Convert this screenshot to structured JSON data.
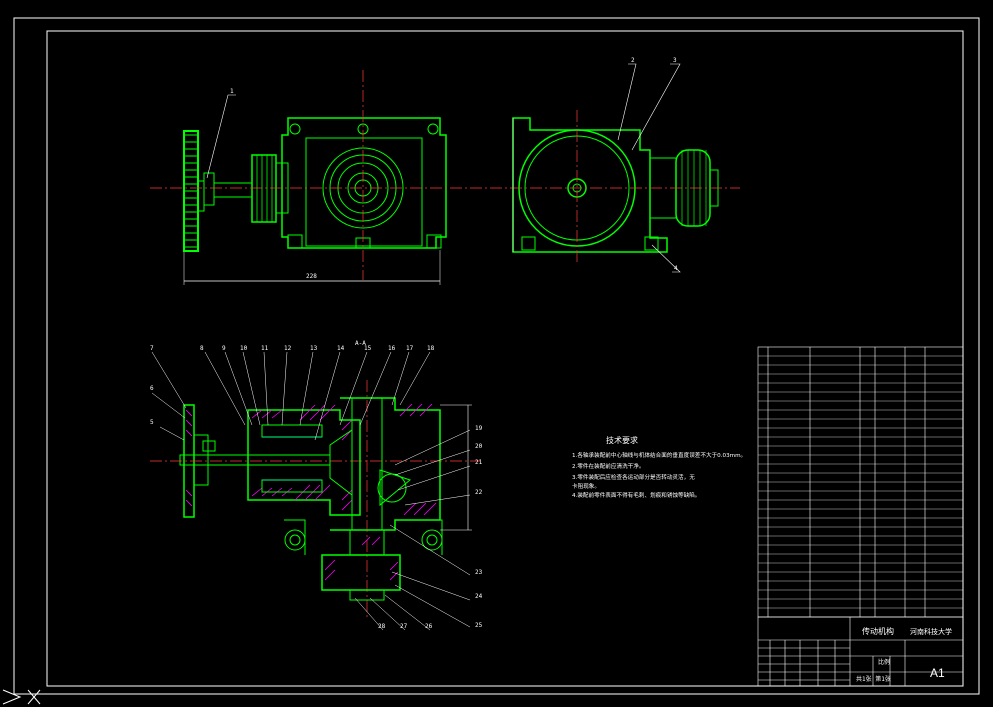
{
  "drawing": {
    "sheet_size": "A1",
    "part_labels_top": [
      "1",
      "2",
      "3",
      "4"
    ],
    "part_labels_section": [
      "5",
      "6",
      "7",
      "8",
      "9",
      "10",
      "11",
      "12",
      "13",
      "14",
      "15",
      "16",
      "17",
      "18",
      "19",
      "20",
      "21",
      "22",
      "23",
      "24",
      "25",
      "26",
      "27",
      "28"
    ],
    "section_mark": "A-A",
    "dim_width": "228",
    "notes_title": "技术要求",
    "notes": [
      "1.各轴承装配前中心轴线与机体结合面的垂直度误差不大于0.03mm。",
      "2.零件在装配前应清洗干净。",
      "3.零件装配后应检查各运动部分是否转动灵活，无",
      "  卡阻现象。",
      "4.装配前零件表面不得有毛刺、划痕和锈蚀等缺陷。"
    ],
    "title_block": {
      "title": "传动机构",
      "school": "河南科技大学",
      "scale_label": "比例",
      "sheet": "共1张 第1张"
    }
  },
  "colors": {
    "line_green": "#00ff00",
    "line_white": "#ffffff",
    "line_red": "#ff3b3b",
    "line_cyan": "#00ffff",
    "hatch_magenta": "#ff00ff",
    "background": "#000000"
  }
}
